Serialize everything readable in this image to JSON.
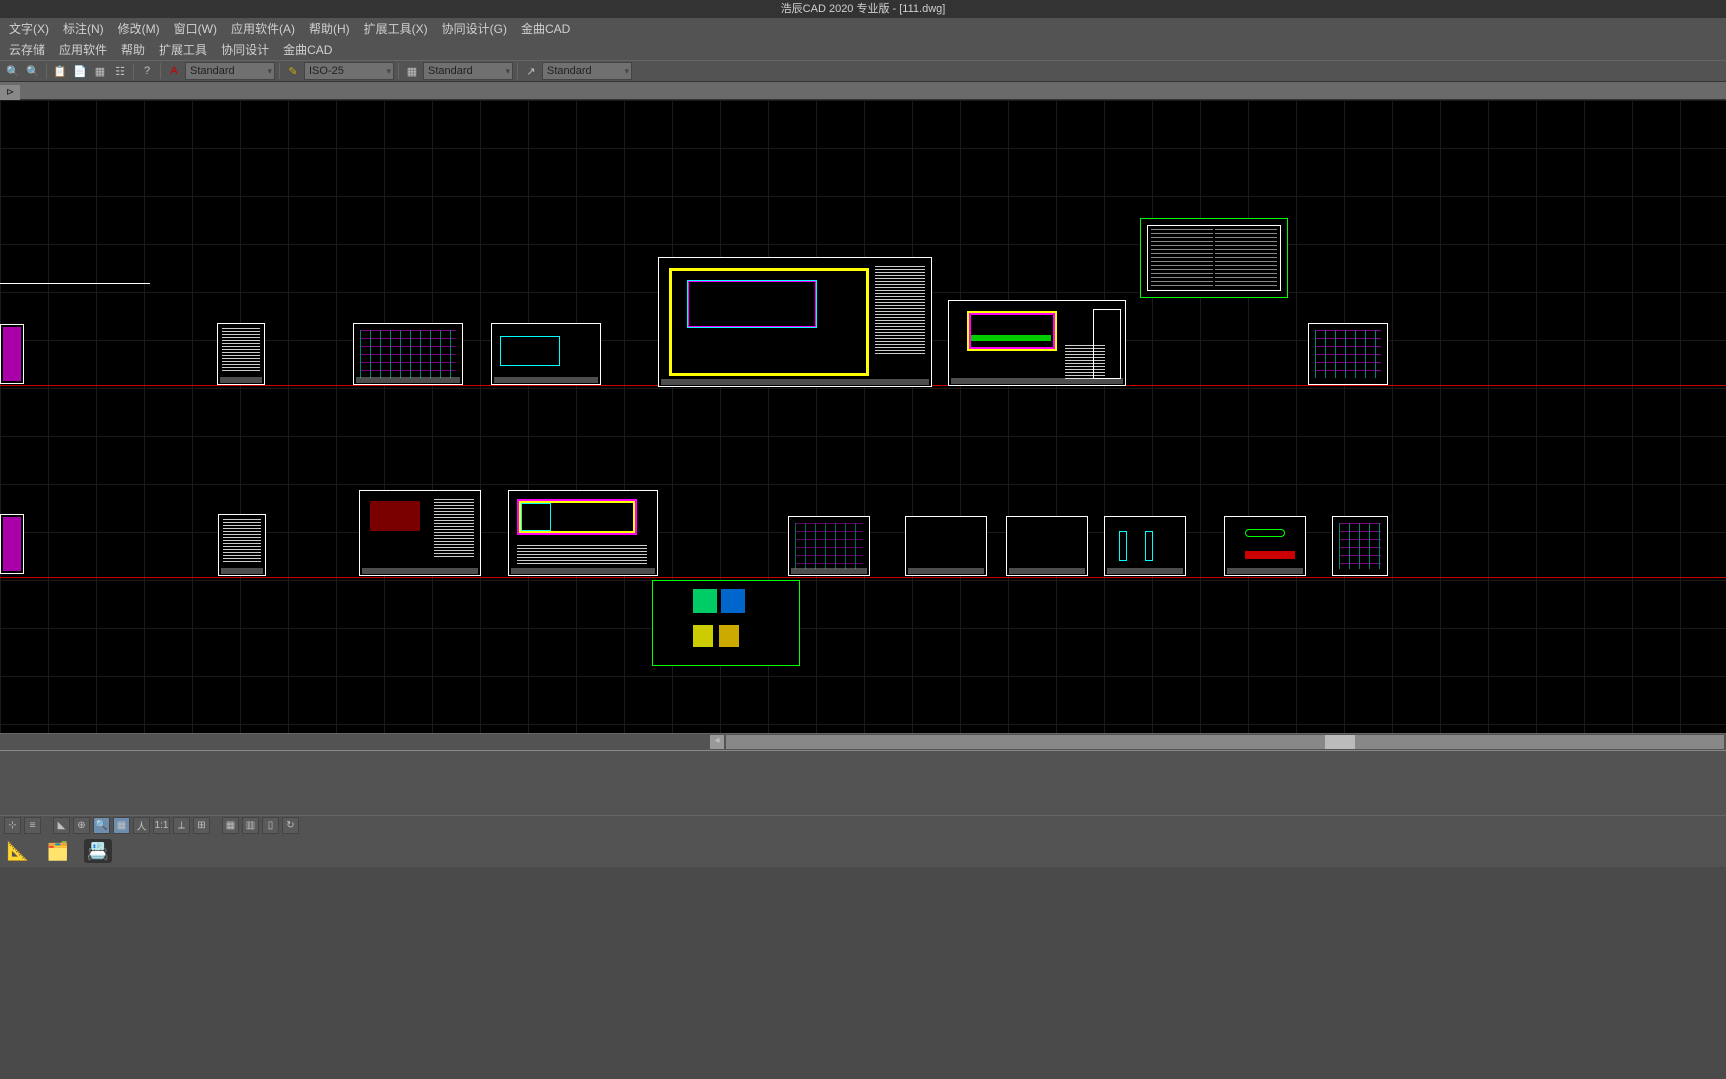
{
  "title": "浩辰CAD 2020 专业版 - [111.dwg]",
  "menu1": {
    "items": [
      "文字(X)",
      "标注(N)",
      "修改(M)",
      "窗口(W)",
      "应用软件(A)",
      "帮助(H)",
      "扩展工具(X)",
      "协同设计(G)",
      "金曲CAD"
    ]
  },
  "menu2": {
    "items": [
      "云存储",
      "应用软件",
      "帮助",
      "扩展工具",
      "协同设计",
      "金曲CAD"
    ]
  },
  "toolbar": {
    "style1": "Standard",
    "dimstyle": "ISO-25",
    "tablestyle": "Standard",
    "mlstyle": "Standard"
  },
  "statusbar": {
    "scale": "1:1"
  },
  "colors": {
    "frame": "#ffffff",
    "yellow": "#ffff00",
    "magenta": "#ff00ff",
    "cyan": "#00ffff",
    "green": "#00ff00",
    "red": "#ff0000"
  }
}
